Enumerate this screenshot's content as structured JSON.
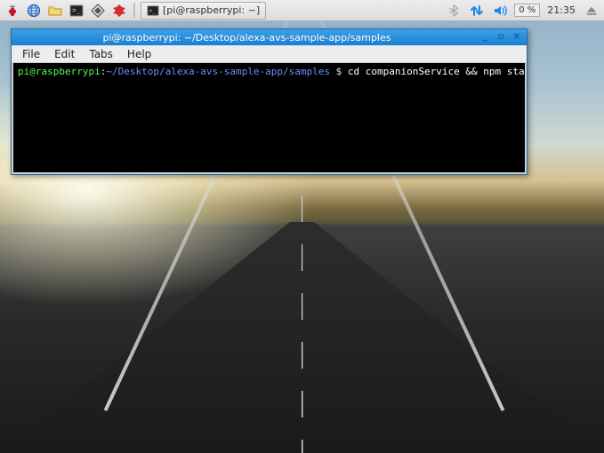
{
  "taskbar": {
    "icons": {
      "menu": "raspberry-menu-icon",
      "web": "globe-icon",
      "files": "file-manager-icon",
      "terminal": "terminal-icon",
      "math": "mathematica-icon",
      "wolfram": "wolfram-icon"
    },
    "task_button": {
      "icon": "terminal-icon",
      "label": "[pi@raspberrypi: ~]"
    },
    "tray": {
      "bluetooth": "bluetooth-icon",
      "network": "network-updown-icon",
      "volume": "speaker-icon",
      "cpu": "0 %",
      "clock": "21:35",
      "eject": "eject-icon"
    }
  },
  "window": {
    "title": "pi@raspberrypi: ~/Desktop/alexa-avs-sample-app/samples",
    "controls": {
      "min": "_",
      "max": "▫",
      "close": "✕"
    },
    "menus": [
      "File",
      "Edit",
      "Tabs",
      "Help"
    ],
    "prompt": {
      "user_host": "pi@raspberrypi",
      "sep1": ":",
      "path": "~/Desktop/alexa-avs-sample-app/samples",
      "dollar": " $ ",
      "command": "cd companionService && npm start"
    }
  }
}
